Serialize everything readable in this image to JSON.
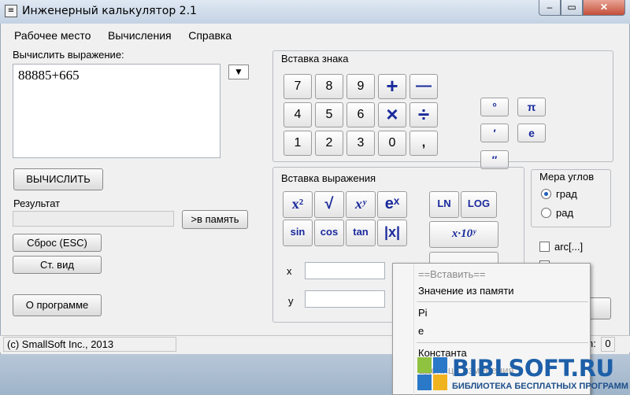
{
  "window": {
    "title": "Инженерный калькулятор 2.1",
    "min_glyph": "–",
    "max_glyph": "▭",
    "close_glyph": "✕"
  },
  "menu": [
    "Рабочее место",
    "Вычисления",
    "Справка"
  ],
  "expression": {
    "label": "Вычислить выражение:",
    "value": "88885+665",
    "dropdown_glyph": "▼"
  },
  "actions": {
    "calc": "ВЫЧИСЛИТЬ",
    "result_label": "Результат",
    "result_value": "",
    "to_memory": ">в память",
    "reset": "Сброс (ESC)",
    "std_view": "Ст. вид",
    "about": "О программе"
  },
  "insert_sign": {
    "title": "Вставка знака",
    "keys": [
      "7",
      "8",
      "9",
      "+",
      "—",
      "4",
      "5",
      "6",
      "×",
      "÷",
      "1",
      "2",
      "3",
      "0",
      ","
    ],
    "extra": [
      "°",
      "π",
      "′",
      "e",
      "″"
    ]
  },
  "insert_expr": {
    "title": "Вставка выражения",
    "funcs_row1": [
      "x²",
      "√",
      "xʸ",
      "eˣ"
    ],
    "funcs_row2": [
      "sin",
      "cos",
      "tan",
      "|x|"
    ],
    "log_keys": [
      "LN",
      "LOG"
    ],
    "sci_key": "x·10ʸ",
    "x_label": "x",
    "y_label": "y"
  },
  "angles": {
    "title": "Мера углов",
    "options": [
      "град",
      "рад"
    ],
    "selected": "град",
    "arc_label": "arc[...]"
  },
  "context_menu": {
    "header": "==Вставить==",
    "items": [
      "Значение из памяти",
      "Pi",
      "e",
      "Константа",
      "Еденица измерения"
    ],
    "faded_item": "Еденица измерения"
  },
  "status": {
    "copyright": "(c) SmallSoft Inc., 2013",
    "right_label": "n:",
    "right_value": "0"
  },
  "watermark": {
    "brand": "BIBLSOFT.RU",
    "tagline": "БИБЛИОТЕКА БЕСПЛАТНЫХ ПРОГРАММ"
  },
  "colors": {
    "accent": "#1a2a9c",
    "brand": "#1d5fa8"
  }
}
